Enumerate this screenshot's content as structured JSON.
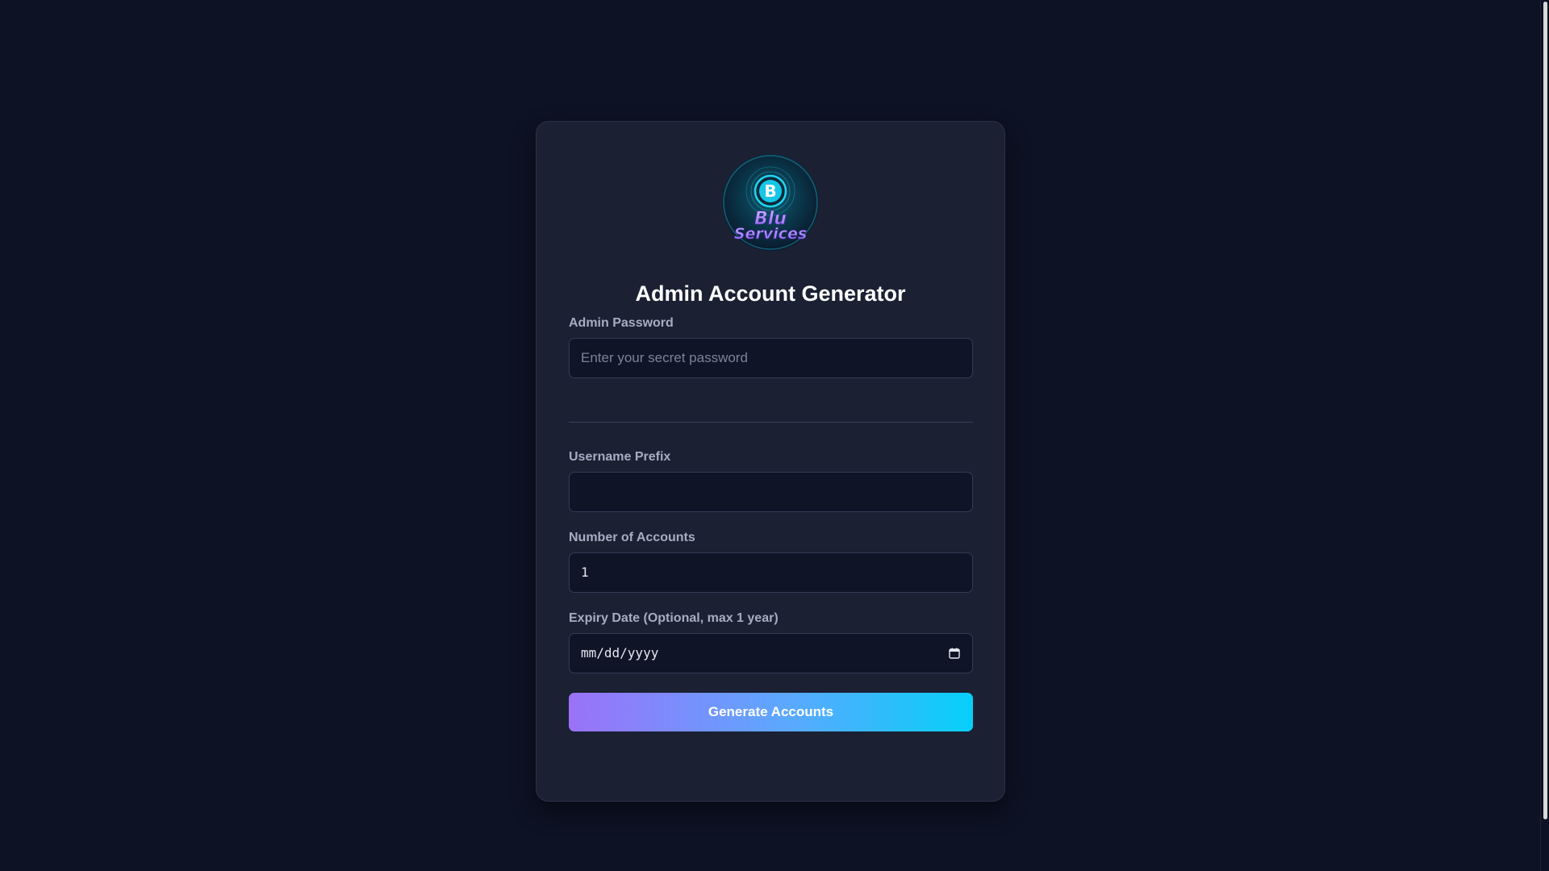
{
  "logo": {
    "letter": "B",
    "line1": "Blu",
    "line2": "Services",
    "icon": "blu-services-logo"
  },
  "title": "Admin Account Generator",
  "form": {
    "admin_password": {
      "label": "Admin Password",
      "placeholder": "Enter your secret password",
      "value": ""
    },
    "username_prefix": {
      "label": "Username Prefix",
      "placeholder": "",
      "value": ""
    },
    "number_of_accounts": {
      "label": "Number of Accounts",
      "value": "1"
    },
    "expiry_date": {
      "label": "Expiry Date (Optional, max 1 year)",
      "placeholder": "mm/dd/yyyy",
      "icon": "calendar-icon"
    },
    "submit_label": "Generate Accounts"
  },
  "colors": {
    "page_background": "#0d1224",
    "card_background": "#1b2033",
    "input_background": "#0f1426",
    "button_gradient_start": "#9b72f8",
    "button_gradient_end": "#06d0f9",
    "logo_accent": "#1fd6f0"
  }
}
